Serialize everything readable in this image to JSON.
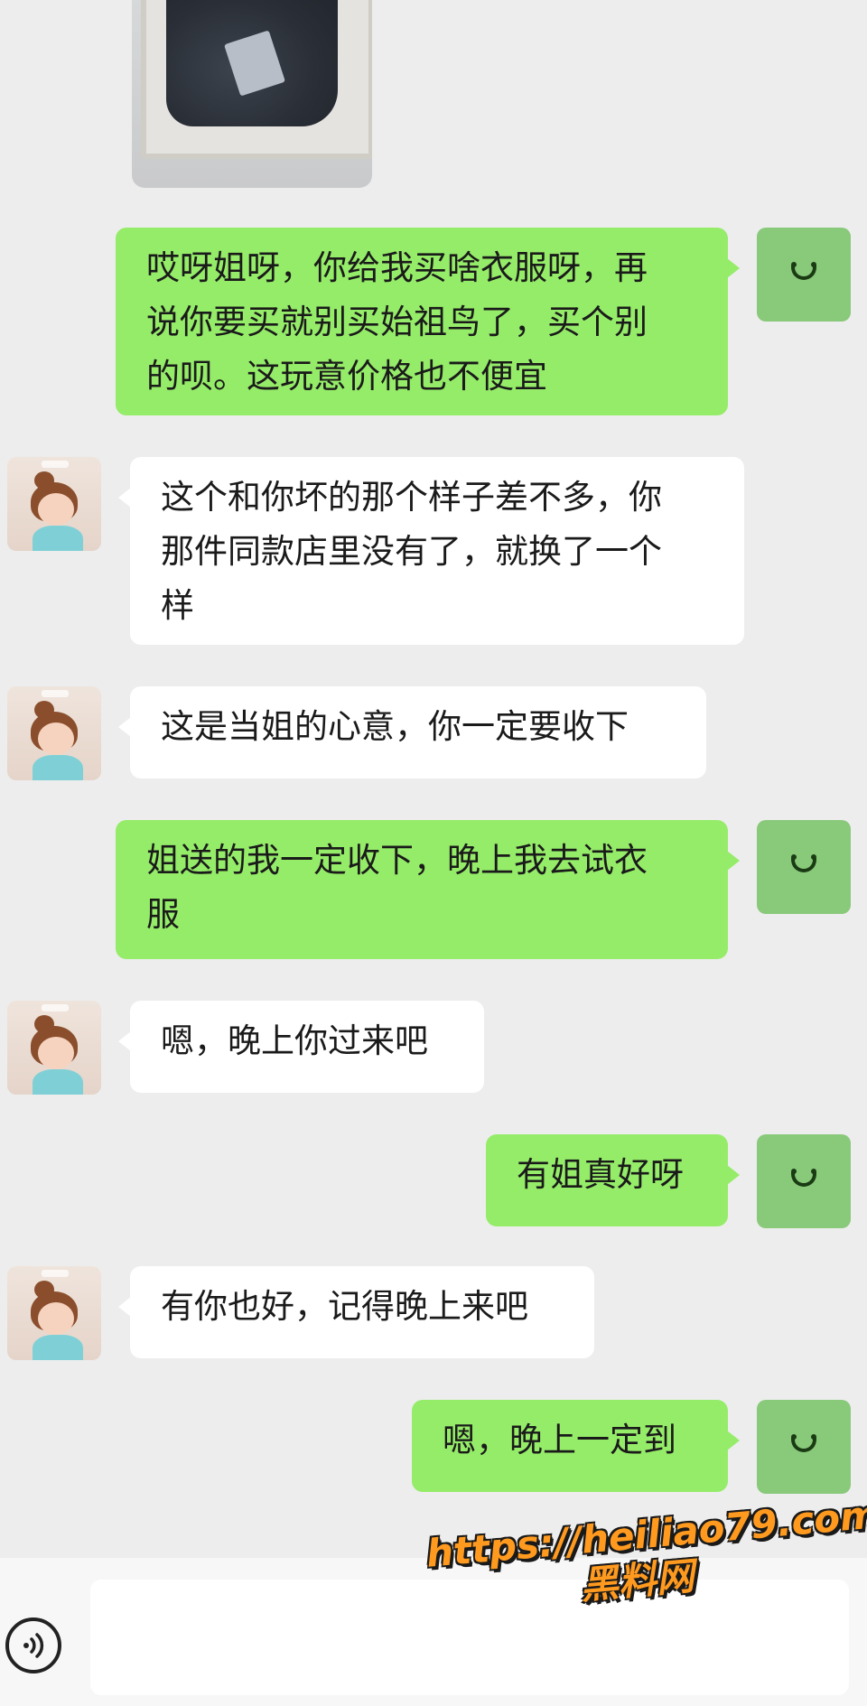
{
  "chat": {
    "shared_photo": {
      "icon": "clothing-photo"
    },
    "messages": [
      {
        "side": "out",
        "text": "哎呀姐呀，你给我买啥衣服呀，再\n说你要买就别买始祖鸟了，买个别\n的呗。这玩意价格也不便宜"
      },
      {
        "side": "in",
        "text": "这个和你坏的那个样子差不多，你\n那件同款店里没有了，就换了一个\n样"
      },
      {
        "side": "in",
        "text": "这是当姐的心意，你一定要收下"
      },
      {
        "side": "out",
        "text": "姐送的我一定收下，晚上我去试衣\n服"
      },
      {
        "side": "in",
        "text": "嗯，晚上你过来吧"
      },
      {
        "side": "out",
        "text": "有姐真好呀"
      },
      {
        "side": "in",
        "text": "有你也好，记得晚上来吧"
      },
      {
        "side": "out",
        "text": "嗯，晚上一定到"
      }
    ]
  },
  "input_bar": {
    "voice_icon": "voice-icon",
    "text_value": ""
  },
  "watermark": {
    "url": "https://heiliao79.com",
    "site": "黑料网"
  },
  "colors": {
    "background": "#ededed",
    "outgoing_bubble": "#95ec69",
    "incoming_bubble": "#ffffff",
    "watermark": "#ff9a1f"
  }
}
